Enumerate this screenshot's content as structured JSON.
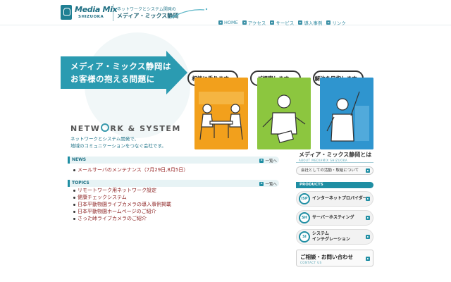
{
  "header": {
    "logo_text": "Media Mix",
    "logo_sub": "SHIZUOKA",
    "tagline_small": "ネットワークとシステム開発の",
    "tagline_big": "メディア・ミックス静岡"
  },
  "nav": {
    "items": [
      {
        "label": "HOME"
      },
      {
        "label": "アクセス"
      },
      {
        "label": "サービス"
      },
      {
        "label": "導入事例"
      },
      {
        "label": "リンク"
      }
    ]
  },
  "hero": {
    "title_line1": "メディア・ミックス静岡は",
    "title_line2": "お客様の抱える問題に",
    "network_prefix": "NETW",
    "network_suffix": "RK & SYSTEM",
    "sub_line1": "ネットワークとシステム開発で、",
    "sub_line2": "地域のコミュニケーションをつなぐ会社です。",
    "bubbles": [
      "相談に乗ります。",
      "ご提案します。",
      "解決を目指します。"
    ]
  },
  "news": {
    "label": "NEWS",
    "more": "一覧へ",
    "items": [
      "メールサーバのメンテナンス（7月29日,8月5日）"
    ]
  },
  "topics": {
    "label": "TOPICS",
    "more": "一覧へ",
    "items": [
      "リモートワーク用ネットワーク設定",
      "健康チェックシステム",
      "日本平動物園ライブカメラの導入事例掲載",
      "日本平動物園ホームページのご紹介",
      "さった峠ライブカメラのご紹介"
    ]
  },
  "about": {
    "title": "メディア・ミックス静岡とは",
    "sub": "ABOUT MEDIAMIX SHIZUOKA",
    "link": "会社としての活動・取組について"
  },
  "products": {
    "label": "PRODUCTS",
    "items": [
      {
        "badge": "ISP",
        "label": "インターネットプロバイダー"
      },
      {
        "badge": "SH",
        "label": "サーバーホスティング"
      },
      {
        "badge": "SI",
        "label_line1": "システム",
        "label_line2": "インテグレーション"
      }
    ]
  },
  "contact": {
    "title": "ご相談・お問い合わせ",
    "sub": "CONTACT US"
  },
  "colors": {
    "accent": "#1f8ea3",
    "orange": "#f2a01c",
    "green": "#8cc63f",
    "blue": "#2f95cf"
  }
}
